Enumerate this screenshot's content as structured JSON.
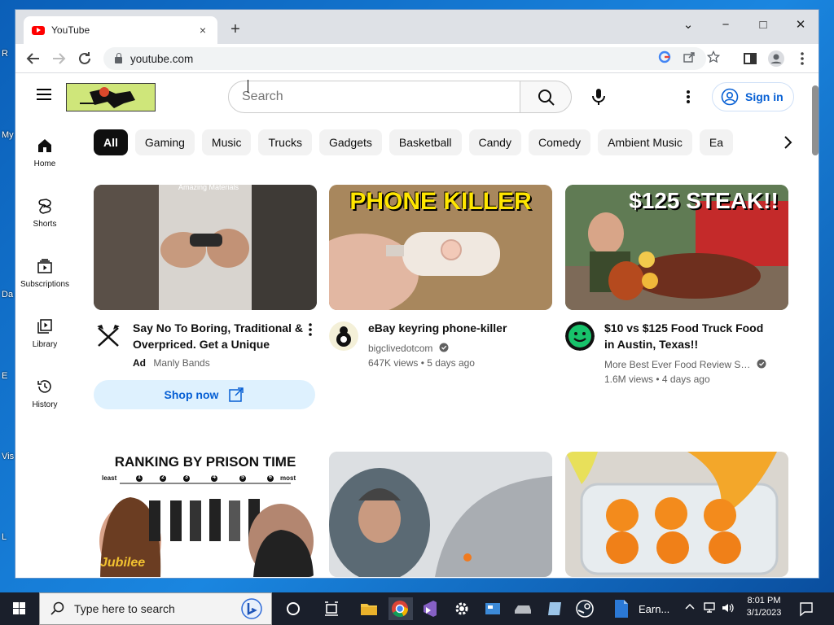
{
  "desktop": {
    "labels": [
      "R",
      "My",
      "Da",
      "E",
      "Vis",
      "L"
    ]
  },
  "browser": {
    "tab_title": "YouTube",
    "tab_close": "×",
    "new_tab": "+",
    "url": "youtube.com",
    "window_controls": {
      "minimize": "−",
      "restore": "□",
      "close": "✕",
      "tabsearch": "⌄"
    }
  },
  "youtube": {
    "search_placeholder": "Search",
    "sign_in": "Sign in",
    "rail": [
      {
        "label": "Home",
        "icon": "home-icon"
      },
      {
        "label": "Shorts",
        "icon": "shorts-icon"
      },
      {
        "label": "Subscriptions",
        "icon": "subscriptions-icon"
      },
      {
        "label": "Library",
        "icon": "library-icon"
      },
      {
        "label": "History",
        "icon": "history-icon"
      }
    ],
    "chips": [
      "All",
      "Gaming",
      "Music",
      "Trucks",
      "Gadgets",
      "Basketball",
      "Candy",
      "Comedy",
      "Ambient Music",
      "Ea"
    ],
    "videos": [
      {
        "title": "Say No To Boring, Traditional & Overpriced. Get a Unique Band…",
        "ad_label": "Ad",
        "channel": "Manly Bands",
        "cta": "Shop now",
        "thumb_caption": "Amazing Materials"
      },
      {
        "title": "eBay keyring phone-killer",
        "channel": "bigclivedotcom",
        "views": "647K views",
        "age": "5 days ago",
        "thumb_text": "PHONE KILLER",
        "sep": "•"
      },
      {
        "title": "$10 vs $125 Food Truck Food in Austin, Texas!!",
        "channel": "More Best Ever Food Review S…",
        "views": "1.6M views",
        "age": "4 days ago",
        "thumb_text": "$125 STEAK!!",
        "sep": "•"
      },
      {
        "thumb_text": "RANKING BY PRISON TIME",
        "scale_least": "least",
        "scale_most": "most",
        "scale_nums": [
          "1",
          "2",
          "3",
          "4",
          "5",
          "6"
        ],
        "watermark": "Jubilee"
      },
      {
        "thumb_text": ""
      },
      {
        "thumb_text": ""
      }
    ]
  },
  "taskbar": {
    "search_placeholder": "Type here to search",
    "app_label": "Earn...",
    "time": "8:01 PM",
    "date": "3/1/2023"
  }
}
